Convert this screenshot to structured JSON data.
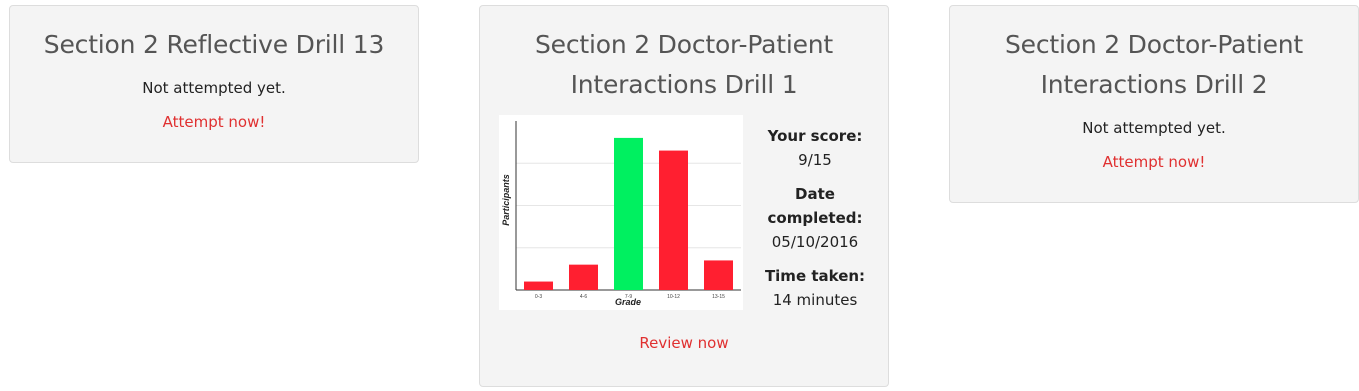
{
  "cards": [
    {
      "title": "Section 2 Reflective Drill 13",
      "status": "Not attempted yet.",
      "action": "Attempt now!"
    },
    {
      "title": "Section 2 Doctor-Patient Interactions Drill 1",
      "score_label": "Your score:",
      "score_value": "9/15",
      "date_label": "Date completed:",
      "date_value": "05/10/2016",
      "time_label": "Time taken:",
      "time_value": "14 minutes",
      "action": "Review now"
    },
    {
      "title": "Section 2 Doctor-Patient Interactions Drill 2",
      "status": "Not attempted yet.",
      "action": "Attempt now!"
    }
  ],
  "colors": {
    "accent_link": "#e03030",
    "bar_default": "#ff1f30",
    "bar_highlight": "#00f060"
  },
  "chart_data": {
    "type": "bar",
    "categories": [
      "0-3",
      "4-6",
      "7-9",
      "10-12",
      "13-15"
    ],
    "values": [
      2,
      6,
      36,
      33,
      7
    ],
    "highlight_index": 2,
    "xlabel": "Grade",
    "ylabel": "Participants",
    "ylim": [
      0,
      40
    ],
    "grid": true
  }
}
